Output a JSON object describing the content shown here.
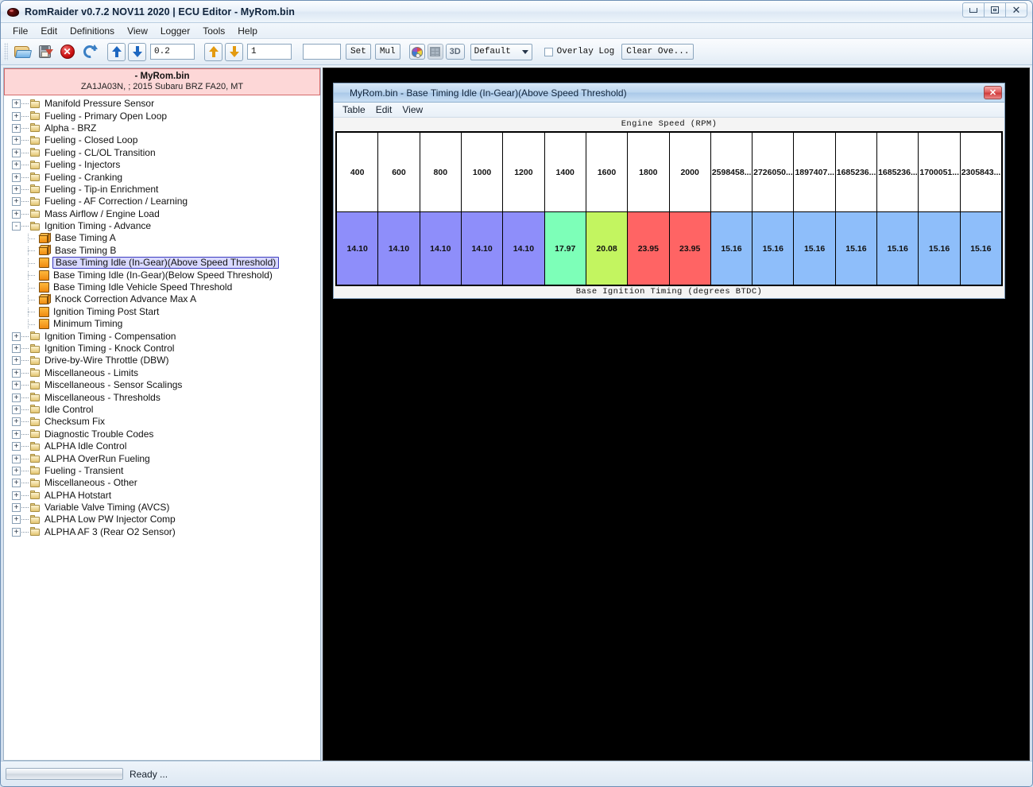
{
  "window": {
    "title": "RomRaider v0.7.2 NOV11 2020 | ECU Editor - MyRom.bin",
    "app_icon": "romraider-icon",
    "controls": {
      "minimize": "minimize-icon",
      "maximize": "maximize-icon",
      "close": "close-icon"
    }
  },
  "menubar": {
    "items": [
      "File",
      "Edit",
      "Definitions",
      "View",
      "Logger",
      "Tools",
      "Help"
    ]
  },
  "toolbar": {
    "icons": [
      "open-image-icon",
      "save-image-icon",
      "close-image-icon",
      "refresh-image-icon"
    ],
    "coarse_up": "increase-coarse-icon",
    "coarse_down": "decrease-coarse-icon",
    "coarse_value": "0.2",
    "fine_up": "increase-fine-icon",
    "fine_down": "decrease-fine-icon",
    "fine_value": "1",
    "set_value": "",
    "set_label": "Set",
    "mul_label": "Mul",
    "palette_icon": "color-palette-icon",
    "grid_icon": "table-grid-icon",
    "threed_label": "3D",
    "layout_selected": "Default",
    "layout_options": [
      "Default"
    ],
    "overlay_log_label": "Overlay Log",
    "overlay_log_checked": false,
    "clear_overlay_label": "Clear Ove..."
  },
  "rom_info": {
    "name": "- MyRom.bin",
    "details": "ZA1JA03N, ; 2015 Subaru BRZ FA20, MT"
  },
  "tree": [
    {
      "label": "Manifold Pressure Sensor",
      "icon": "folder-icon",
      "depth": 0,
      "expander": "+"
    },
    {
      "label": "Fueling - Primary Open Loop",
      "icon": "folder-icon",
      "depth": 0,
      "expander": "+"
    },
    {
      "label": "Alpha - BRZ",
      "icon": "folder-icon",
      "depth": 0,
      "expander": "+"
    },
    {
      "label": "Fueling - Closed Loop",
      "icon": "folder-icon",
      "depth": 0,
      "expander": "+"
    },
    {
      "label": "Fueling - CL/OL Transition",
      "icon": "folder-icon",
      "depth": 0,
      "expander": "+"
    },
    {
      "label": "Fueling - Injectors",
      "icon": "folder-icon",
      "depth": 0,
      "expander": "+"
    },
    {
      "label": "Fueling - Cranking",
      "icon": "folder-icon",
      "depth": 0,
      "expander": "+"
    },
    {
      "label": "Fueling - Tip-in Enrichment",
      "icon": "folder-icon",
      "depth": 0,
      "expander": "+"
    },
    {
      "label": "Fueling - AF Correction / Learning",
      "icon": "folder-icon",
      "depth": 0,
      "expander": "+"
    },
    {
      "label": "Mass Airflow / Engine Load",
      "icon": "folder-icon",
      "depth": 0,
      "expander": "+"
    },
    {
      "label": "Ignition Timing - Advance",
      "icon": "folder-icon",
      "depth": 0,
      "expander": "-"
    },
    {
      "label": "Base Timing A",
      "icon": "table3d-icon",
      "depth": 1,
      "expander": ""
    },
    {
      "label": "Base Timing B",
      "icon": "table3d-icon",
      "depth": 1,
      "expander": ""
    },
    {
      "label": "Base Timing Idle (In-Gear)(Above Speed Threshold)",
      "icon": "table2d-icon",
      "depth": 1,
      "expander": "",
      "selected": true
    },
    {
      "label": "Base Timing Idle (In-Gear)(Below Speed Threshold)",
      "icon": "table2d-icon",
      "depth": 1,
      "expander": ""
    },
    {
      "label": "Base Timing Idle Vehicle Speed Threshold",
      "icon": "table2d-icon",
      "depth": 1,
      "expander": ""
    },
    {
      "label": "Knock Correction Advance Max A",
      "icon": "table3d-icon",
      "depth": 1,
      "expander": ""
    },
    {
      "label": "Ignition Timing Post Start",
      "icon": "table2d-icon",
      "depth": 1,
      "expander": ""
    },
    {
      "label": "Minimum Timing",
      "icon": "table2d-icon",
      "depth": 1,
      "expander": ""
    },
    {
      "label": "Ignition Timing - Compensation",
      "icon": "folder-icon",
      "depth": 0,
      "expander": "+"
    },
    {
      "label": "Ignition Timing - Knock Control",
      "icon": "folder-icon",
      "depth": 0,
      "expander": "+"
    },
    {
      "label": "Drive-by-Wire Throttle (DBW)",
      "icon": "folder-icon",
      "depth": 0,
      "expander": "+"
    },
    {
      "label": "Miscellaneous - Limits",
      "icon": "folder-icon",
      "depth": 0,
      "expander": "+"
    },
    {
      "label": "Miscellaneous - Sensor Scalings",
      "icon": "folder-icon",
      "depth": 0,
      "expander": "+"
    },
    {
      "label": "Miscellaneous - Thresholds",
      "icon": "folder-icon",
      "depth": 0,
      "expander": "+"
    },
    {
      "label": "Idle Control",
      "icon": "folder-icon",
      "depth": 0,
      "expander": "+"
    },
    {
      "label": "Checksum Fix",
      "icon": "folder-icon",
      "depth": 0,
      "expander": "+"
    },
    {
      "label": "Diagnostic Trouble Codes",
      "icon": "folder-icon",
      "depth": 0,
      "expander": "+"
    },
    {
      "label": "ALPHA Idle Control",
      "icon": "folder-icon",
      "depth": 0,
      "expander": "+"
    },
    {
      "label": "ALPHA OverRun Fueling",
      "icon": "folder-icon",
      "depth": 0,
      "expander": "+"
    },
    {
      "label": "Fueling - Transient",
      "icon": "folder-icon",
      "depth": 0,
      "expander": "+"
    },
    {
      "label": "Miscellaneous - Other",
      "icon": "folder-icon",
      "depth": 0,
      "expander": "+"
    },
    {
      "label": "ALPHA Hotstart",
      "icon": "folder-icon",
      "depth": 0,
      "expander": "+"
    },
    {
      "label": "Variable Valve Timing (AVCS)",
      "icon": "folder-icon",
      "depth": 0,
      "expander": "+"
    },
    {
      "label": "ALPHA Low PW Injector Comp",
      "icon": "folder-icon",
      "depth": 0,
      "expander": "+"
    },
    {
      "label": "ALPHA AF 3 (Rear O2 Sensor)",
      "icon": "folder-icon",
      "depth": 0,
      "expander": "+"
    }
  ],
  "table_window": {
    "title": "MyRom.bin - Base Timing Idle (In-Gear)(Above Speed Threshold)",
    "close_icon": "close-icon",
    "menu": [
      "Table",
      "Edit",
      "View"
    ],
    "axis_top_label": "Engine Speed (RPM)",
    "axis_bottom_label": "Base Ignition Timing (degrees BTDC)"
  },
  "chart_data": {
    "type": "table",
    "title": "Base Timing Idle (In-Gear)(Above Speed Threshold)",
    "xlabel": "Engine Speed (RPM)",
    "ylabel": "Base Ignition Timing (degrees BTDC)",
    "categories": [
      "400",
      "600",
      "800",
      "1000",
      "1200",
      "1400",
      "1600",
      "1800",
      "2000",
      "2598458...",
      "2726050...",
      "1897407...",
      "1685236...",
      "1685236...",
      "1700051...",
      "2305843..."
    ],
    "values": [
      "14.10",
      "14.10",
      "14.10",
      "14.10",
      "14.10",
      "17.97",
      "20.08",
      "23.95",
      "23.95",
      "15.16",
      "15.16",
      "15.16",
      "15.16",
      "15.16",
      "15.16",
      "15.16"
    ],
    "cell_colors": [
      "#8e8efa",
      "#8e8efa",
      "#8e8efa",
      "#8e8efa",
      "#8e8efa",
      "#7dffb8",
      "#c3f560",
      "#ff6464",
      "#ff6464",
      "#8ebefa",
      "#8ebefa",
      "#8ebefa",
      "#8ebefa",
      "#8ebefa",
      "#8ebefa",
      "#8ebefa"
    ]
  },
  "statusbar": {
    "progress_value": "",
    "status_text": "Ready ..."
  },
  "colors": {
    "accent_blue": "#3a7fc4",
    "rom_info_bg": "#fdd7d7",
    "selection": "#d9d9ff",
    "canvas": "#000000"
  }
}
